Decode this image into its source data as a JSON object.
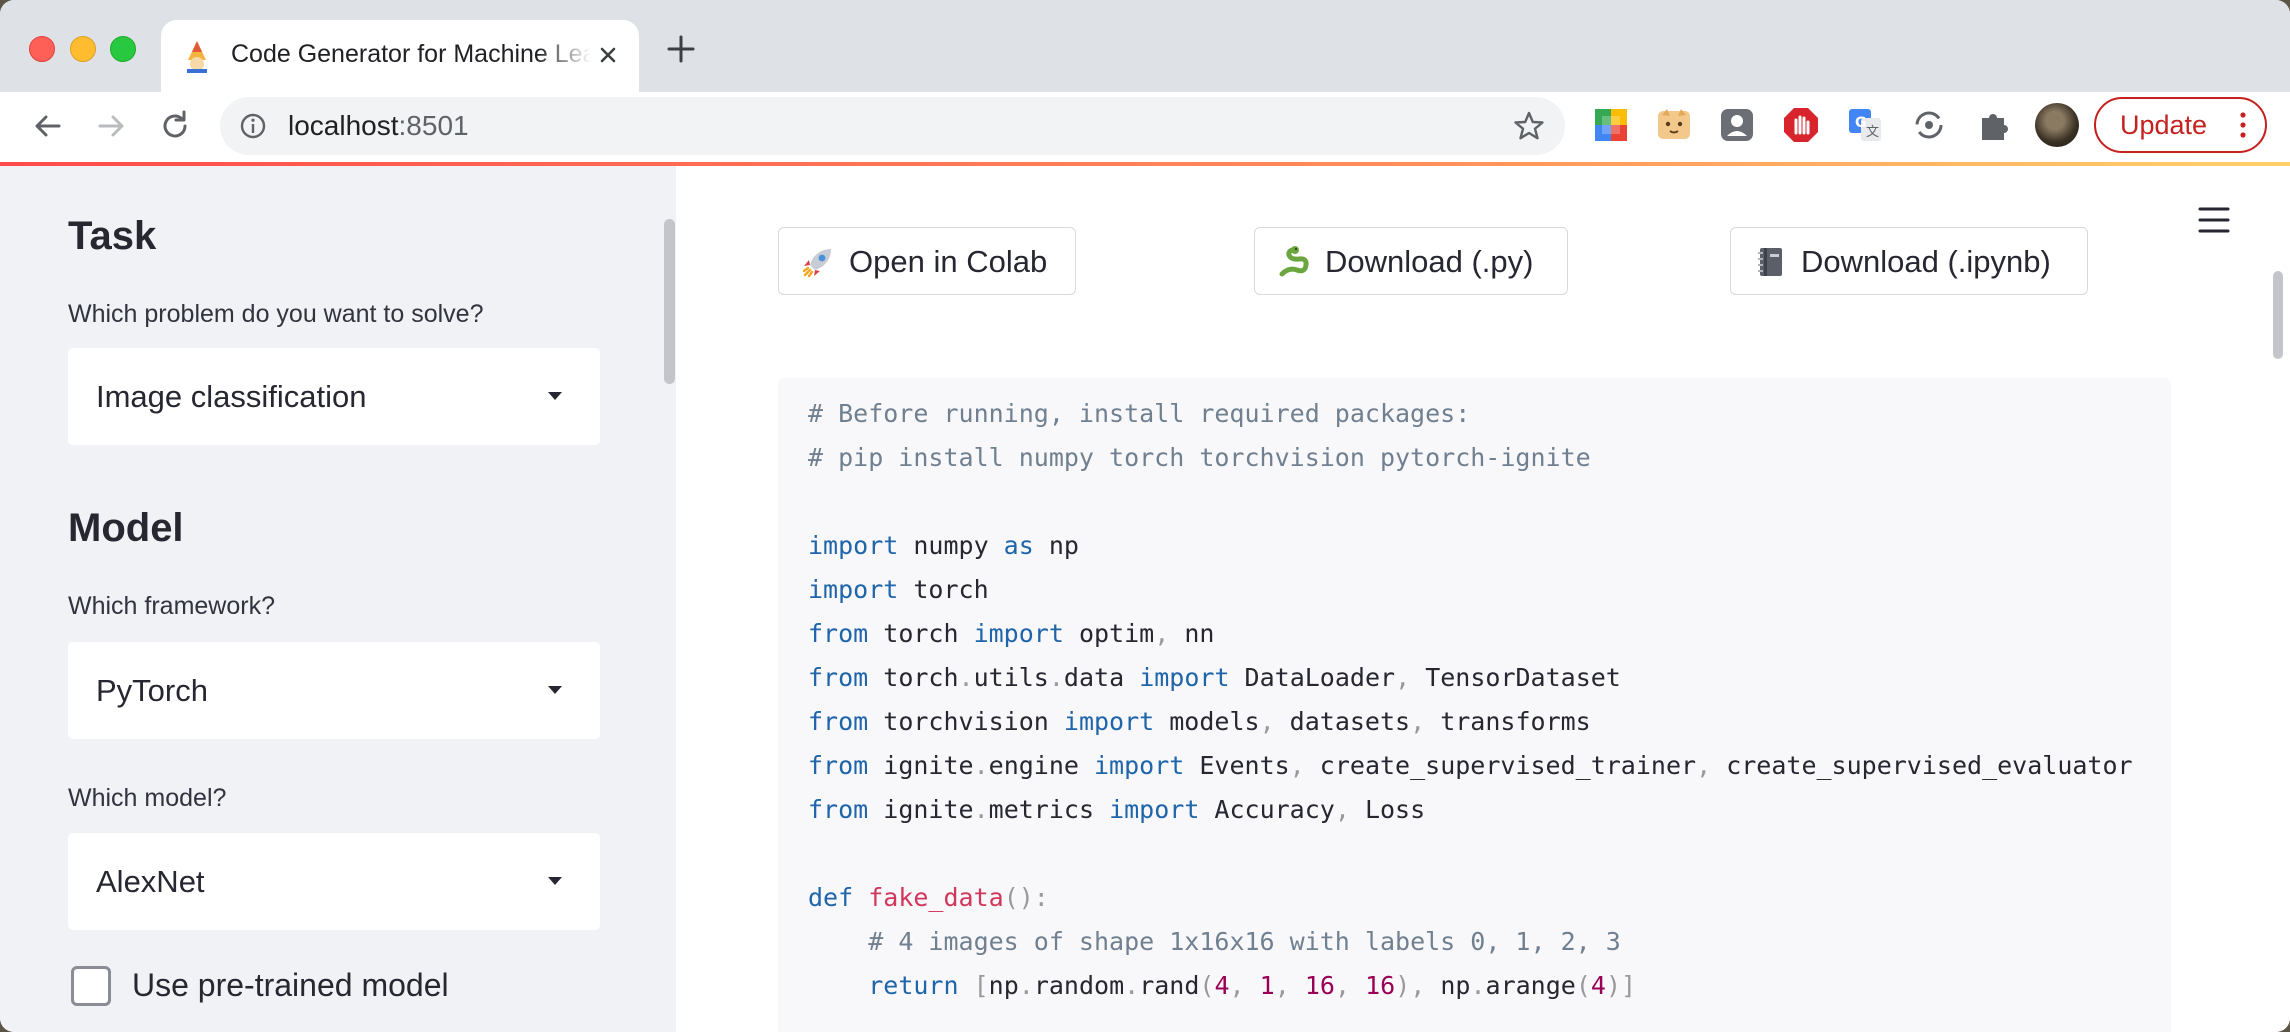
{
  "browser": {
    "tab": {
      "title": "Code Generator for Machine Learning"
    },
    "address": {
      "host": "localhost",
      "port": ":8501"
    },
    "update_label": "Update"
  },
  "sidebar": {
    "task": {
      "heading": "Task",
      "question": "Which problem do you want to solve?",
      "selected": "Image classification"
    },
    "model": {
      "heading": "Model",
      "framework_question": "Which framework?",
      "framework_selected": "PyTorch",
      "model_question": "Which model?",
      "model_selected": "AlexNet",
      "pretrained_label": "Use pre-trained model",
      "pretrained_checked": false
    }
  },
  "main": {
    "buttons": {
      "colab": "Open in Colab",
      "py": "Download (.py)",
      "ipynb": "Download (.ipynb)"
    },
    "code": {
      "c1": "# Before running, install required packages:",
      "c2": "# pip install numpy torch torchvision pytorch-ignite",
      "c3": "# 4 images of shape 1x16x16 with labels 0, 1, 2, 3",
      "def_name": "fake_data"
    }
  },
  "colors": {
    "accent": "#ff4b4b",
    "sidebar_bg": "#f0f2f6",
    "code_bg": "#f8f8fa",
    "keyword": "#1f65a9",
    "comment": "#708090",
    "function": "#d1365c",
    "number": "#990055"
  }
}
